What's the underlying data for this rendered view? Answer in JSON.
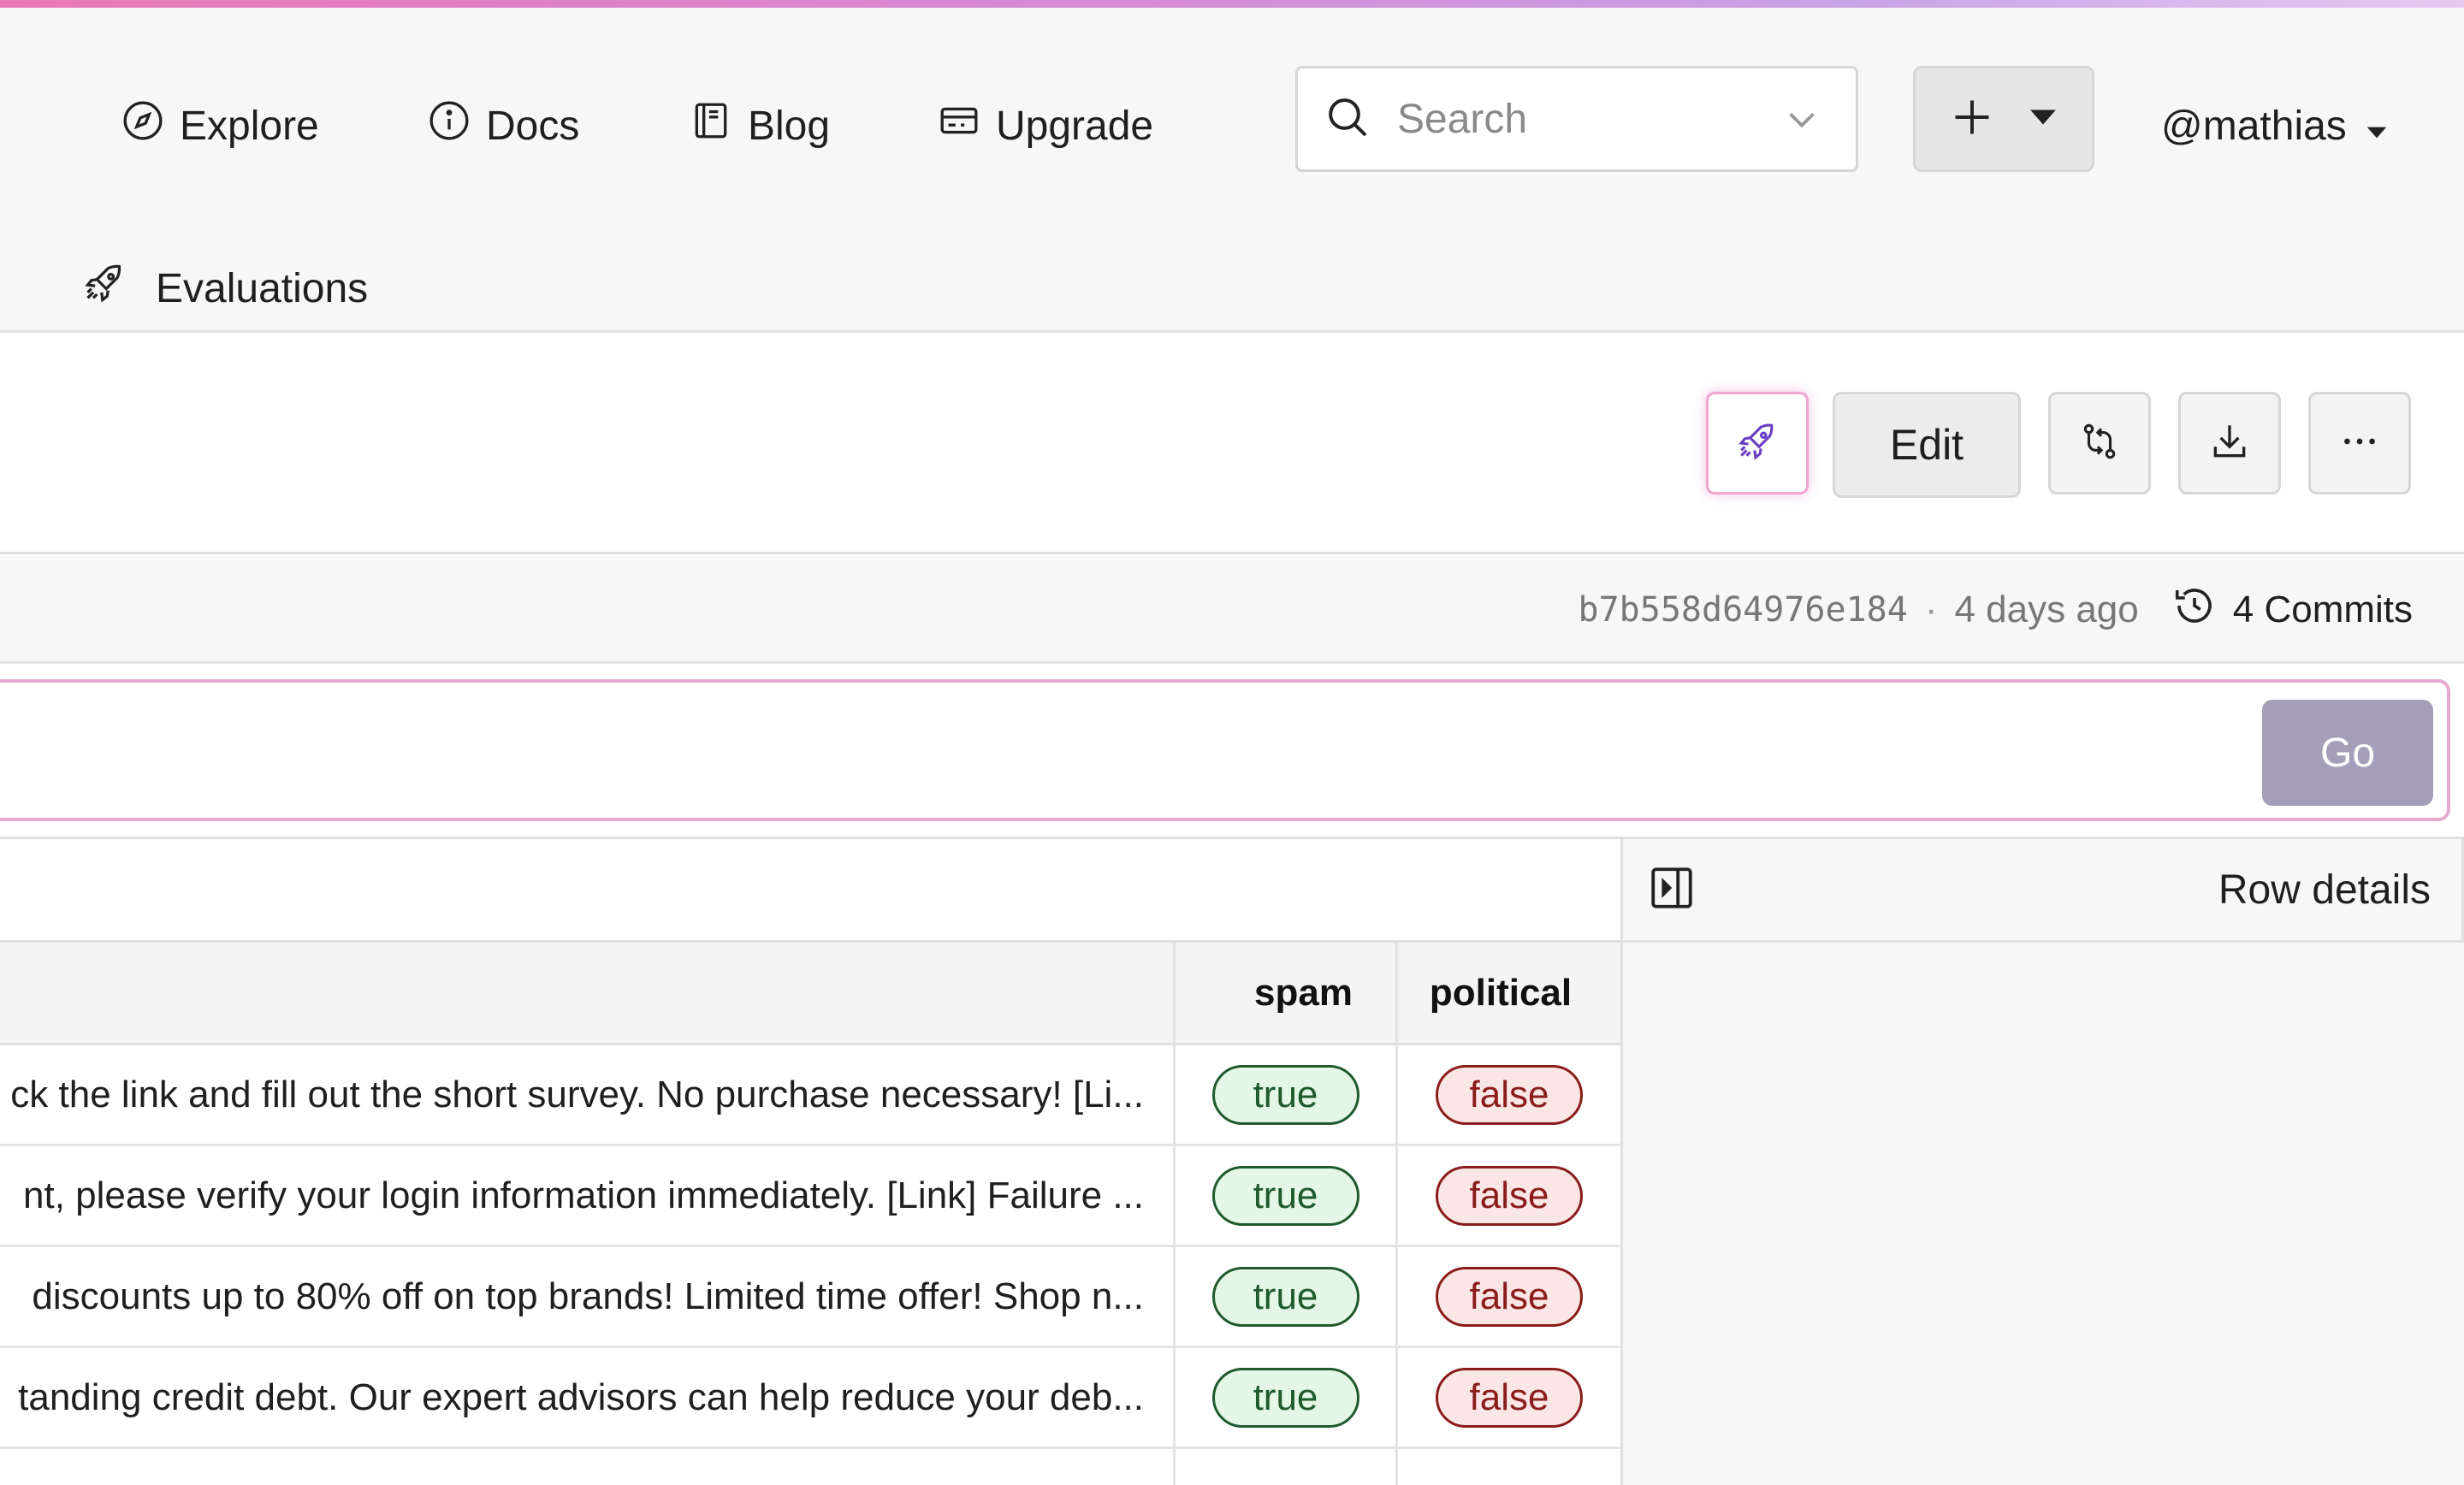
{
  "nav": {
    "links": [
      {
        "label": "Explore",
        "icon": "compass-icon"
      },
      {
        "label": "Docs",
        "icon": "info-icon"
      },
      {
        "label": "Blog",
        "icon": "book-icon"
      },
      {
        "label": "Upgrade",
        "icon": "credit-card-icon"
      }
    ],
    "search_placeholder": "Search",
    "user": "@mathias",
    "evaluations_label": "Evaluations"
  },
  "toolbar": {
    "edit_label": "Edit"
  },
  "commit": {
    "hash": "b7b558d64976e184",
    "separator": "·",
    "age": "4 days ago",
    "commits_label": "4 Commits"
  },
  "prompt": {
    "go_label": "Go"
  },
  "details": {
    "title": "Row details"
  },
  "table": {
    "columns": {
      "spam": "spam",
      "political": "political"
    },
    "rows": [
      {
        "text": "ck the link and fill out the short survey. No purchase necessary! [Li...",
        "spam": "true",
        "political": "false"
      },
      {
        "text": "nt, please verify your login information immediately. [Link] Failure ...",
        "spam": "true",
        "political": "false"
      },
      {
        "text": "discounts up to 80% off on top brands! Limited time offer! Shop n...",
        "spam": "true",
        "political": "false"
      },
      {
        "text": "tanding credit debt. Our expert advisors can help reduce your deb...",
        "spam": "true",
        "political": "false"
      }
    ]
  },
  "colors": {
    "accent_pink": "#e7a9cd",
    "go_button": "#a59eb8",
    "true_bg": "#e4f6e6",
    "true_fg": "#1f5a2e",
    "false_bg": "#fbe6e6",
    "false_fg": "#8a1c1c"
  }
}
